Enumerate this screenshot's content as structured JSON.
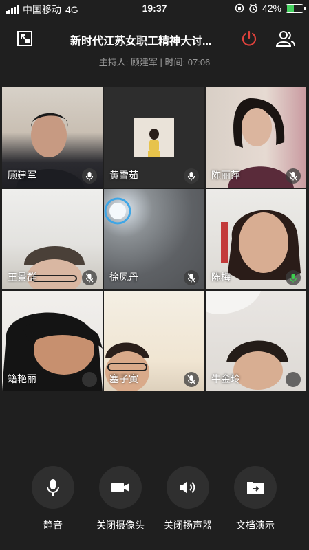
{
  "status_bar": {
    "carrier": "中国移动",
    "network": "4G",
    "time": "19:37",
    "battery": "42%",
    "battery_level": 0.42
  },
  "header": {
    "title": "新时代江苏女职工精神大讨...",
    "host_info": "主持人: 顾建军 | 时间: 07:06"
  },
  "participants": [
    {
      "name": "顾建军",
      "mic": "on"
    },
    {
      "name": "黄雪茹",
      "mic": "on"
    },
    {
      "name": "陈丽萍",
      "mic": "muted"
    },
    {
      "name": "王景群",
      "mic": "muted"
    },
    {
      "name": "徐凤丹",
      "mic": "muted"
    },
    {
      "name": "陈梅",
      "mic": "speaking"
    },
    {
      "name": "籍艳丽",
      "mic": "none"
    },
    {
      "name": "塞子寅",
      "mic": "muted"
    },
    {
      "name": "牛金玲",
      "mic": "none"
    }
  ],
  "controls": {
    "mute_label": "静音",
    "camera_label": "关闭摄像头",
    "speaker_label": "关闭扬声器",
    "share_label": "文档演示"
  },
  "colors": {
    "accent_red": "#e0423c",
    "mic_active": "#3ccf4e",
    "background": "#1f1f1f"
  }
}
